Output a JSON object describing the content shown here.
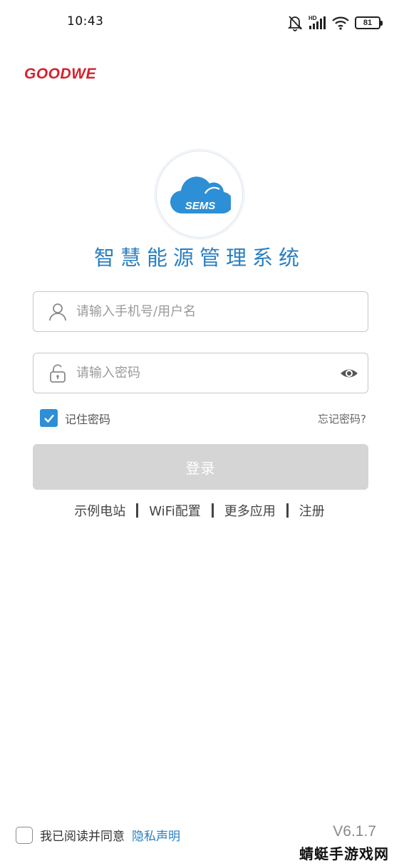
{
  "status_bar": {
    "time": "10:43",
    "network_label": "HD",
    "battery_level": "81",
    "icons": [
      "mute-bell-icon",
      "signal-icon",
      "wifi-icon",
      "battery-icon"
    ]
  },
  "brand": {
    "name": "GOODWE",
    "color": "#d6202d"
  },
  "logo": {
    "text": "SEMS",
    "color": "#2d8fd5"
  },
  "app_title": "智慧能源管理系统",
  "login_form": {
    "username": {
      "value": "",
      "placeholder": "请输入手机号/用户名",
      "icon": "user-icon"
    },
    "password": {
      "value": "",
      "placeholder": "请输入密码",
      "icon": "lock-icon",
      "toggle_icon": "eye-icon"
    },
    "remember_label": "记住密码",
    "remember_checked": true,
    "forgot_label": "忘记密码?",
    "submit_label": "登录"
  },
  "links": [
    "示例电站",
    "WiFi配置",
    "更多应用",
    "注册"
  ],
  "footer": {
    "agree_text": "我已阅读并同意",
    "privacy_link": "隐私声明",
    "version": "V6.1.7",
    "watermark": "蜻蜓手游戏网"
  },
  "colors": {
    "accent": "#2a7fc1",
    "checkbox": "#2d8fd5",
    "button_disabled": "#d5d5d5"
  }
}
